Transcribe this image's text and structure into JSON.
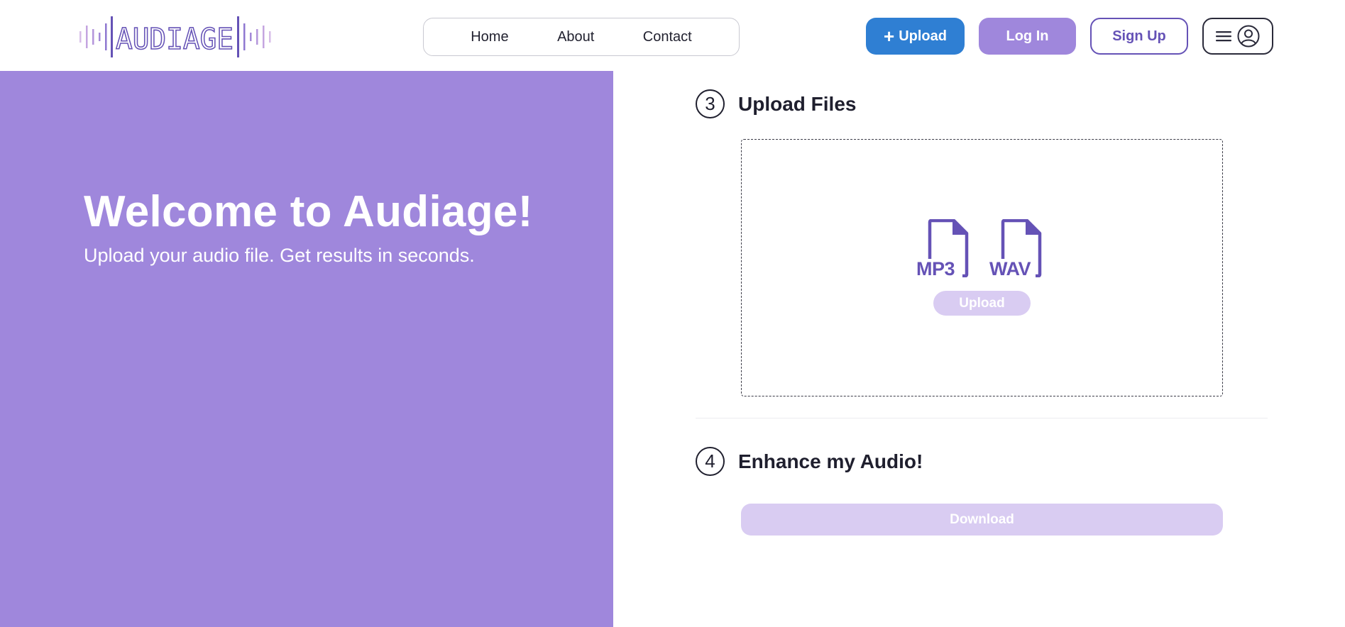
{
  "header": {
    "logo_text": "AUDIAGE",
    "nav": [
      {
        "label": "Home"
      },
      {
        "label": "About"
      },
      {
        "label": "Contact"
      }
    ],
    "upload_button": {
      "icon": "plus-icon",
      "label": "Upload"
    },
    "login_label": "Log In",
    "signup_label": "Sign Up",
    "menu_icons": [
      "hamburger-icon",
      "user-avatar-icon"
    ]
  },
  "hero": {
    "title": "Welcome to Audiage!",
    "subtitle": "Upload your audio file. Get results in seconds."
  },
  "steps": [
    {
      "number": "3",
      "title": "Upload Files"
    },
    {
      "number": "4",
      "title": "Enhance my Audio!"
    }
  ],
  "dropzone": {
    "file_types": [
      "MP3",
      "WAV"
    ],
    "upload_label": "Upload"
  },
  "download_label": "Download",
  "colors": {
    "brand_purple": "#9f87dc",
    "dark_purple": "#6552b6",
    "upload_blue": "#2f7fd3",
    "disabled_purple": "#d9ccf2",
    "logo_light": "#d7bde8"
  }
}
